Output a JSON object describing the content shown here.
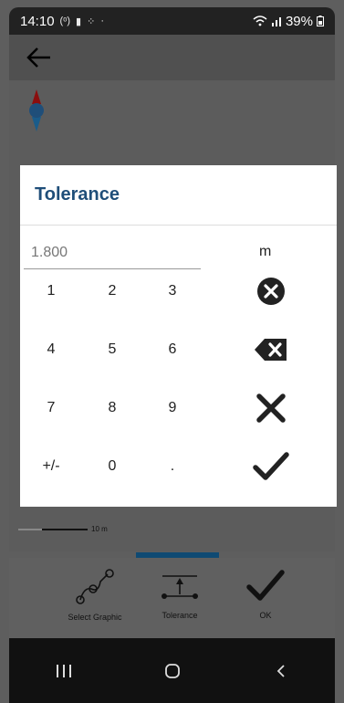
{
  "status": {
    "time": "14:10",
    "battery": "39%"
  },
  "dialog": {
    "title": "Tolerance",
    "value": "1.800",
    "unit": "m"
  },
  "keypad": {
    "row1": [
      "1",
      "2",
      "3"
    ],
    "row2": [
      "4",
      "5",
      "6"
    ],
    "row3": [
      "7",
      "8",
      "9"
    ],
    "row4": [
      "+/-",
      "0",
      "."
    ],
    "actions": [
      "clear-circle-icon",
      "backspace-icon",
      "cancel-icon",
      "confirm-check-icon"
    ]
  },
  "map": {
    "scale_label": "10 m"
  },
  "toolbar": {
    "select_graphic_label": "Select Graphic",
    "tolerance_label": "Tolerance",
    "ok_label": "OK"
  },
  "colors": {
    "title": "#1f4e79",
    "indicator": "#0f4a73"
  }
}
